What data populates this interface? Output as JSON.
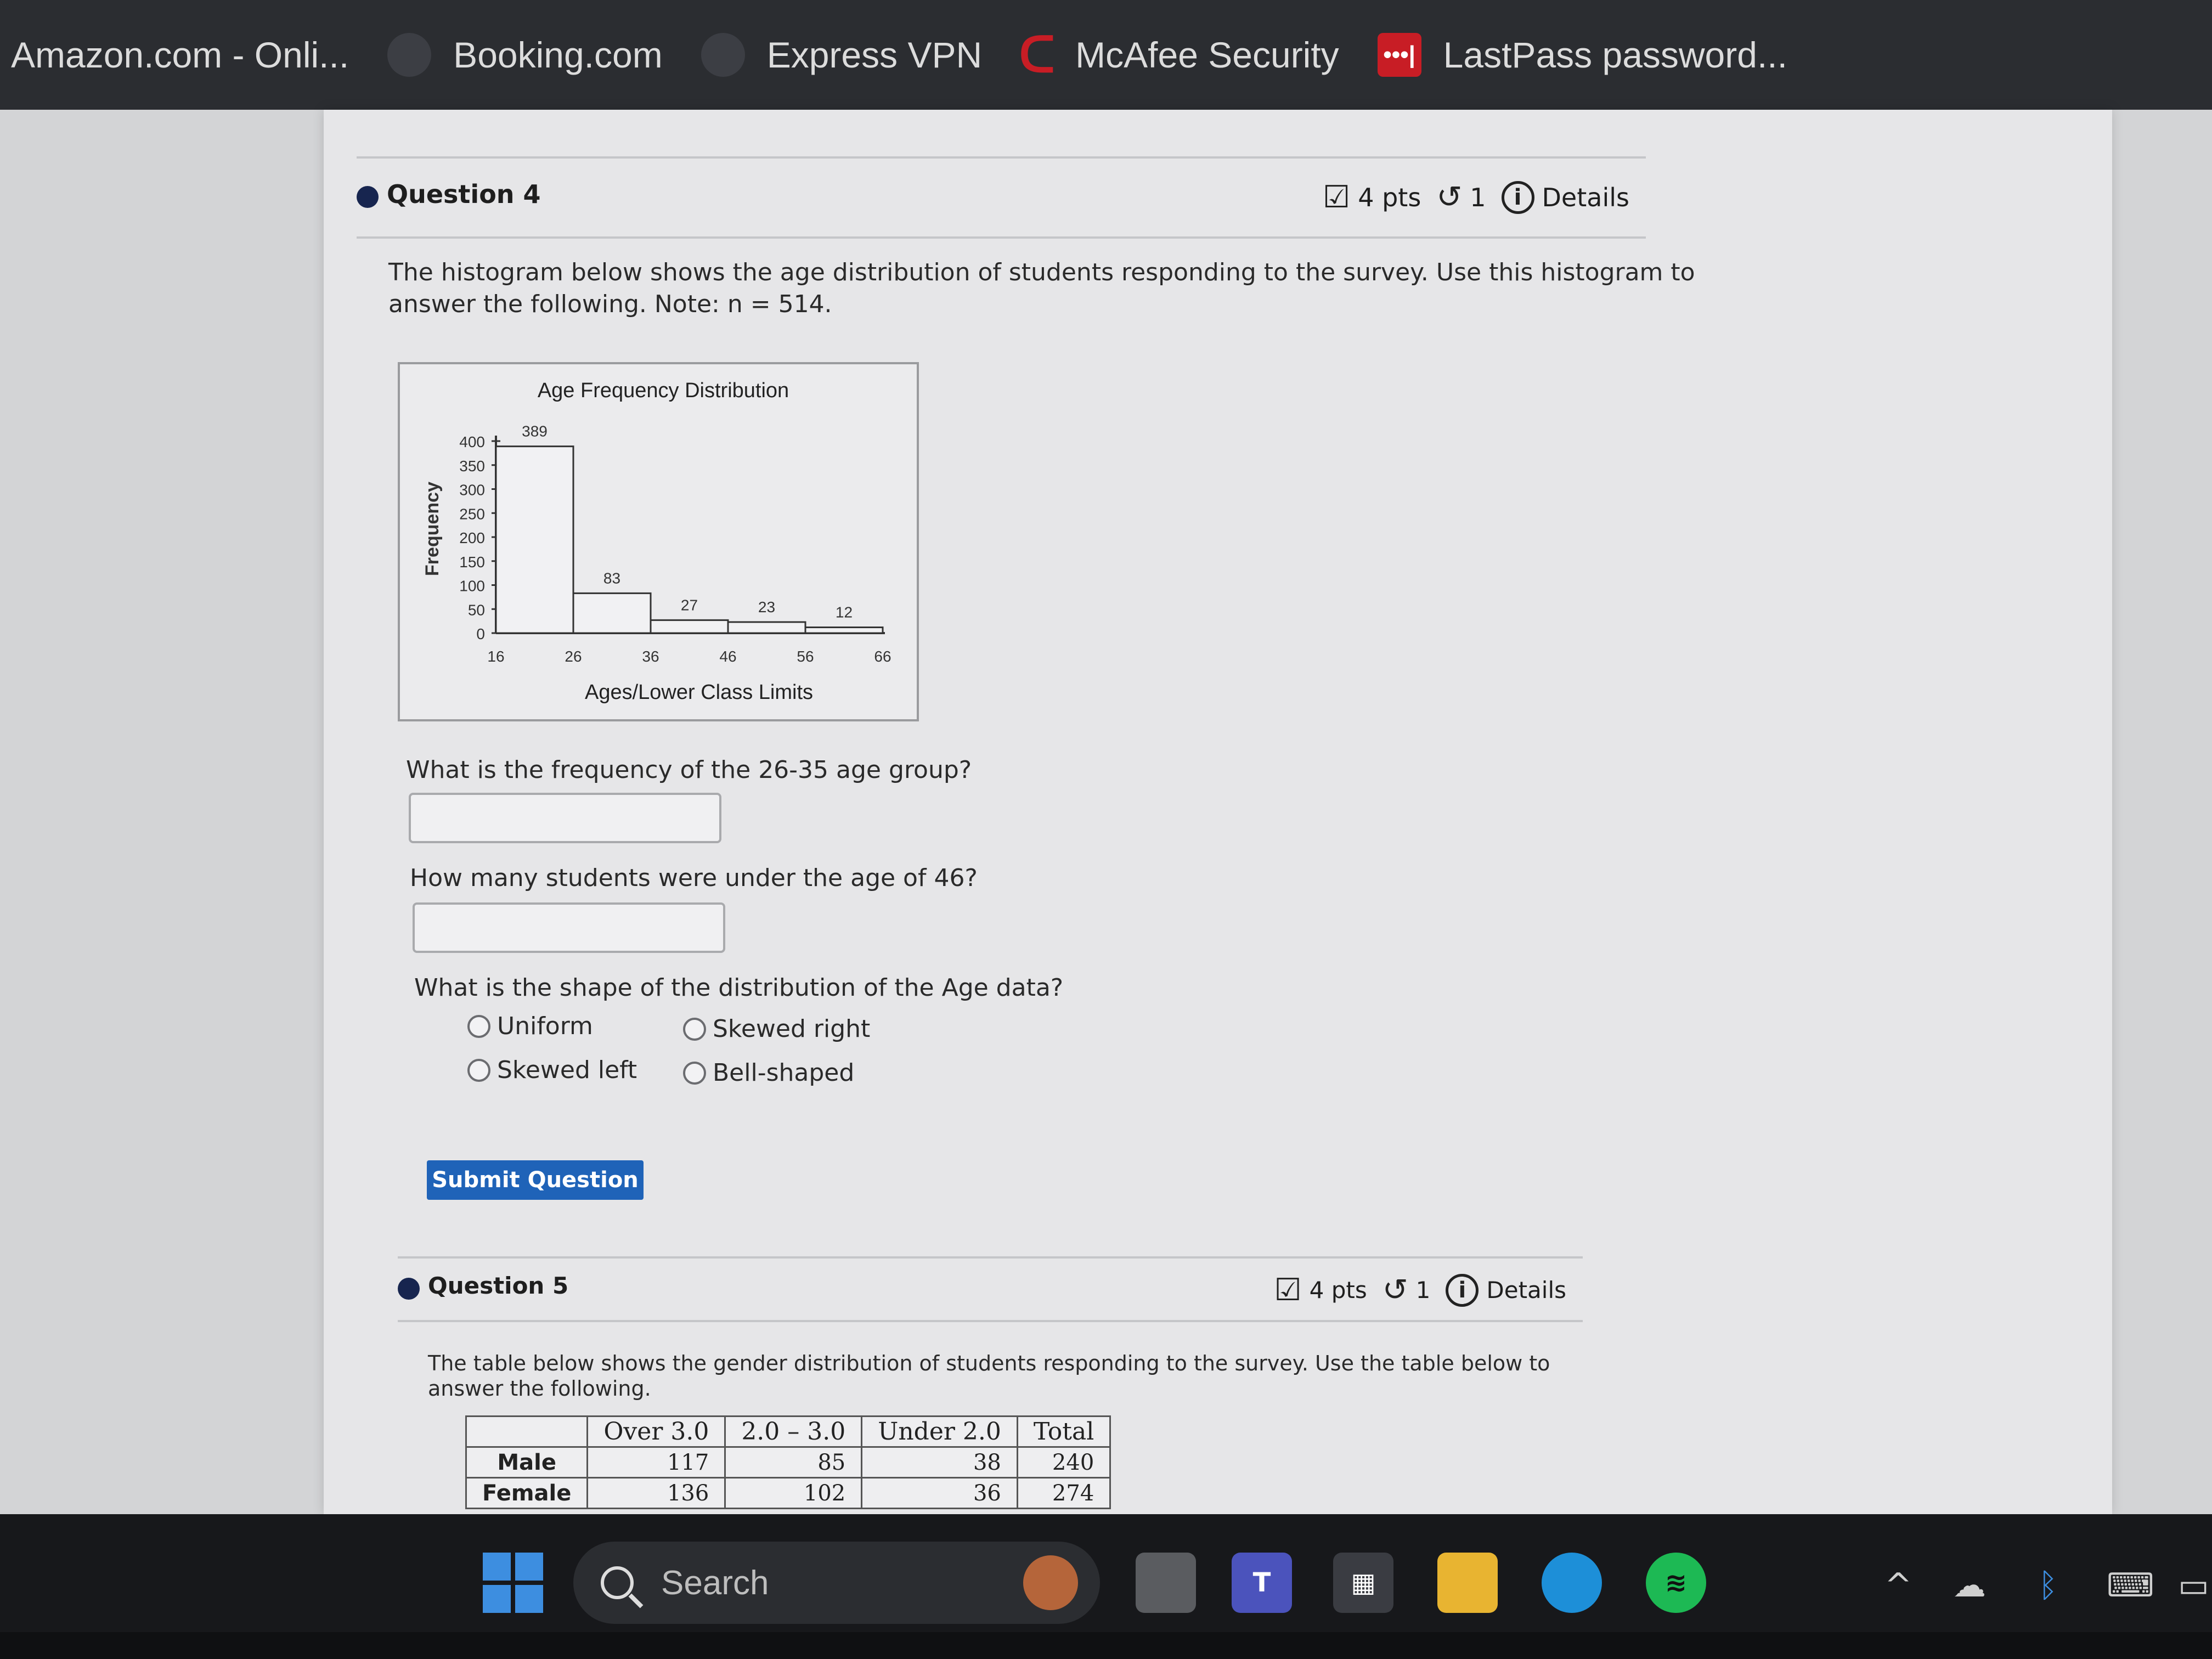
{
  "bookmarks": [
    {
      "label": "Amazon.com - Onli...",
      "icon": "amazon-icon"
    },
    {
      "label": "Booking.com",
      "icon": "booking-icon"
    },
    {
      "label": "Express VPN",
      "icon": "expressvpn-icon"
    },
    {
      "label": "McAfee Security",
      "icon": "mcafee-icon"
    },
    {
      "label": "LastPass password...",
      "icon": "lastpass-icon",
      "fav_text": "•••|"
    }
  ],
  "q4": {
    "title": "Question 4",
    "pts": "4 pts",
    "attempts": "1",
    "details": "Details",
    "prompt_line1": "The histogram below shows the age distribution of students responding to the survey. Use this histogram to",
    "prompt_line2": "answer the following. Note: n = 514.",
    "sub1": "What is the frequency of the 26-35 age group?",
    "sub2": "How many students were under the age of 46?",
    "sub3": "What is the shape of the distribution of the Age data?",
    "options": [
      "Uniform",
      "Skewed right",
      "Skewed left",
      "Bell-shaped"
    ],
    "submit": "Submit Question"
  },
  "chart_data": {
    "type": "bar",
    "title": "Age Frequency Distribution",
    "xlabel": "Ages/Lower Class Limits",
    "ylabel": "Frequency",
    "bin_edges": [
      16,
      26,
      36,
      46,
      56,
      66
    ],
    "values": [
      389,
      83,
      27,
      23,
      12
    ],
    "yticks": [
      0,
      50,
      100,
      150,
      200,
      250,
      300,
      350,
      400
    ],
    "ylim": [
      0,
      400
    ],
    "grid": false
  },
  "q5": {
    "title": "Question 5",
    "pts": "4 pts",
    "attempts": "1",
    "details": "Details",
    "prompt_line1": "The table below shows the gender distribution of students responding to the survey. Use the table below to",
    "prompt_line2": "answer the following.",
    "table": {
      "headers": [
        "",
        "Over  3.0",
        "2.0 – 3.0",
        "Under  2.0",
        "Total"
      ],
      "rows": [
        [
          "Male",
          "117",
          "85",
          "38",
          "240"
        ],
        [
          "Female",
          "136",
          "102",
          "36",
          "274"
        ]
      ]
    }
  },
  "taskbar": {
    "search_placeholder": "Search"
  }
}
